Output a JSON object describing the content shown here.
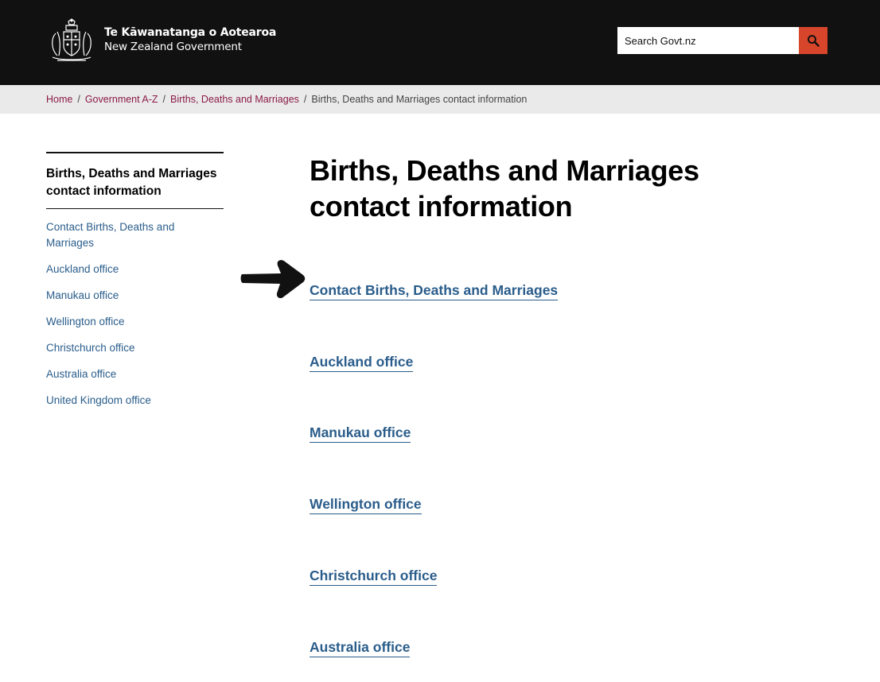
{
  "header": {
    "logo_maori": "Te Kāwanatanga o Aotearoa",
    "logo_english": "New Zealand Government",
    "search_placeholder": "Search Govt.nz",
    "brand_color": "#d7452b"
  },
  "breadcrumb": {
    "items": [
      "Home",
      "Government A-Z",
      "Births, Deaths and Marriages"
    ],
    "current": "Births, Deaths and Marriages contact information",
    "separator": "/"
  },
  "sidebar": {
    "title": "Births, Deaths and Marriages contact information",
    "items": [
      "Contact Births, Deaths and Marriages",
      "Auckland office",
      "Manukau office",
      "Wellington office",
      "Christchurch office",
      "Australia office",
      "United Kingdom office"
    ]
  },
  "main": {
    "title": "Births, Deaths and Marriages contact information",
    "arrow_icon": "pointing-arrow-icon",
    "links": [
      "Contact Births, Deaths and Marriages",
      "Auckland office",
      "Manukau office",
      "Wellington office",
      "Christchurch office",
      "Australia office"
    ]
  }
}
